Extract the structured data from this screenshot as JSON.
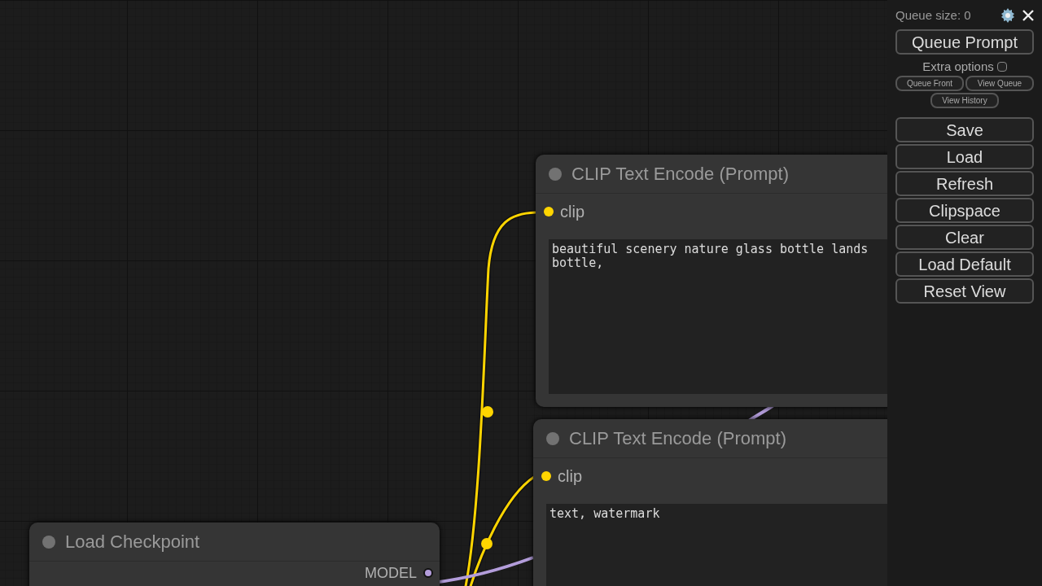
{
  "nodes": [
    {
      "title": "CLIP Text Encode (Prompt)",
      "inputs": [
        {
          "label": "clip",
          "color": "#ffd500"
        }
      ],
      "text_lines": [
        "beautiful scenery nature glass bottle lands",
        "bottle,"
      ]
    },
    {
      "title": "CLIP Text Encode (Prompt)",
      "inputs": [
        {
          "label": "clip",
          "color": "#ffd500"
        }
      ],
      "text_lines": [
        "text, watermark"
      ]
    },
    {
      "title": "Load Checkpoint",
      "outputs": [
        {
          "label": "MODEL",
          "color": "#b39ddb"
        }
      ]
    }
  ],
  "sidebar": {
    "queue_size": "Queue size: 0",
    "queue_button": "Queue Prompt",
    "extra_options": {
      "label": "Extra options",
      "checked": false
    },
    "small_buttons": [
      "Queue Front",
      "View Queue",
      "View History"
    ],
    "buttons": [
      "Save",
      "Load",
      "Refresh",
      "Clipspace",
      "Clear",
      "Load Default",
      "Reset View"
    ]
  }
}
